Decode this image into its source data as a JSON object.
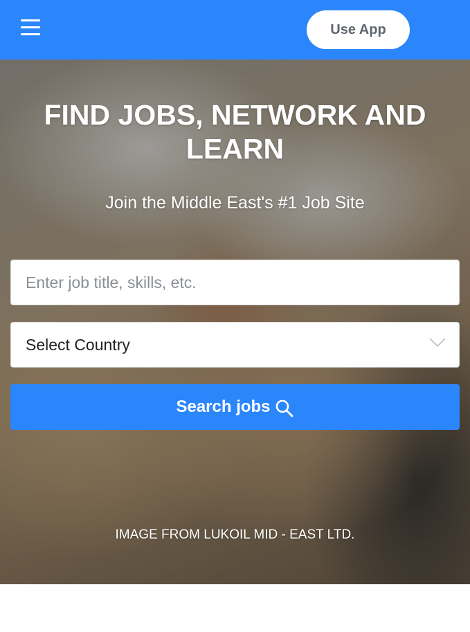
{
  "header": {
    "menu_icon": "hamburger-menu-icon",
    "use_app_label": "Use App"
  },
  "hero": {
    "title": "FIND JOBS, NETWORK AND LEARN",
    "subtitle": "Join the Middle East's #1 Job Site",
    "job_search": {
      "placeholder": "Enter job title, skills, etc.",
      "value": ""
    },
    "country_select": {
      "selected": "Select Country",
      "icon": "chevron-down-icon"
    },
    "search_button": {
      "label": "Search jobs",
      "icon": "search-icon"
    },
    "image_credit": "IMAGE FROM LUKOIL MID - EAST LTD."
  },
  "colors": {
    "brand_blue": "#2b86fb",
    "button_text": "#5f6670",
    "white": "#ffffff"
  }
}
